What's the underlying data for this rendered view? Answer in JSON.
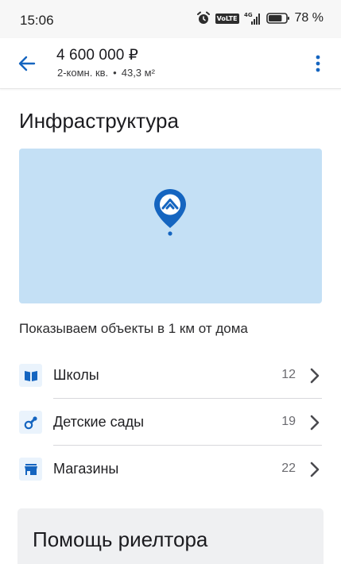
{
  "status_bar": {
    "time": "15:06",
    "volte": "VoLTE",
    "network": "4G",
    "battery_percent": "78 %",
    "battery_level": 0.78
  },
  "header": {
    "price": "4 600 000 ₽",
    "rooms": "2-комн. кв.",
    "separator": "•",
    "area": "43,3 м²"
  },
  "infrastructure": {
    "title": "Инфраструктура",
    "radius_text": "Показываем объекты в 1 км от дома",
    "items": [
      {
        "label": "Школы",
        "count": "12",
        "icon": "book-icon"
      },
      {
        "label": "Детские сады",
        "count": "19",
        "icon": "pacifier-icon"
      },
      {
        "label": "Магазины",
        "count": "22",
        "icon": "store-icon"
      }
    ]
  },
  "help": {
    "title": "Помощь риелтора"
  },
  "colors": {
    "accent": "#1565c0",
    "map_background": "#c4e0f5",
    "icon_background": "#eaf3fc",
    "card_background": "#eff0f2"
  }
}
